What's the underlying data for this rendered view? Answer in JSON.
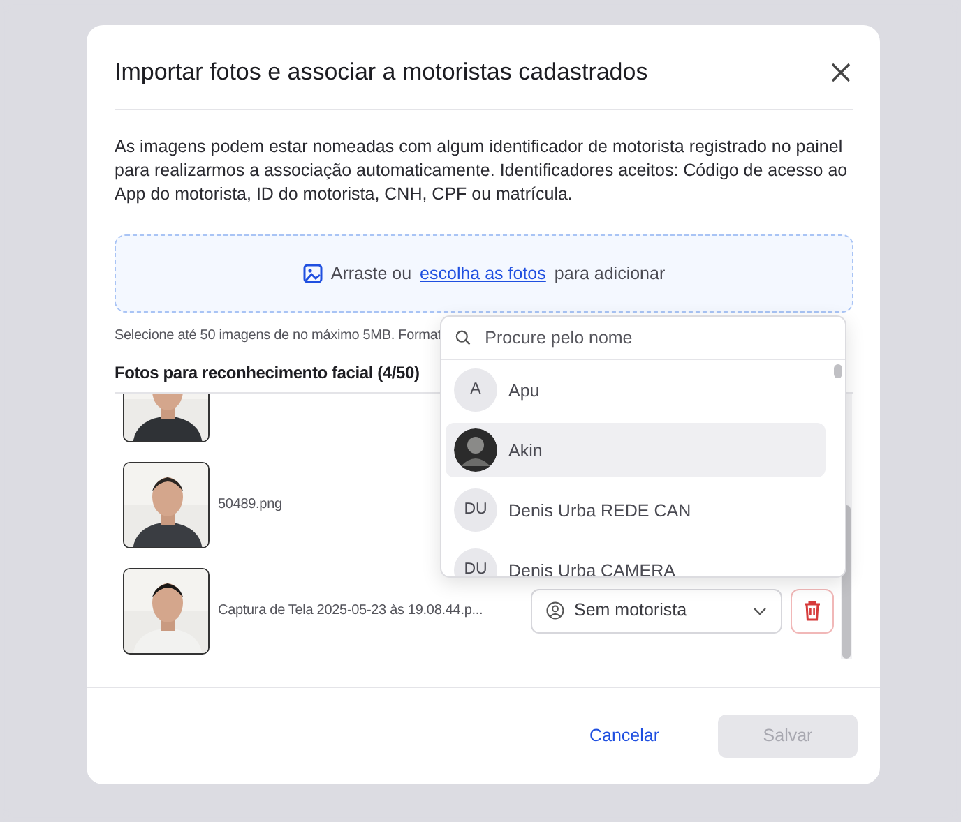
{
  "dialog": {
    "title": "Importar fotos e associar a motoristas cadastrados",
    "description": "As imagens podem estar nomeadas com algum identificador de motorista registrado no painel para realizarmos a associação automaticamente. Identificadores aceitos: Código de acesso ao App do motorista, ID do motorista, CNH, CPF ou matrícula.",
    "dropzone": {
      "before": "Arraste ou",
      "link": "escolha as fotos",
      "after": "para adicionar"
    },
    "hint": "Selecione até 50 imagens de no máximo 5MB. Format",
    "list_title": "Fotos para reconhecimento facial (4/50)",
    "photos": [
      {
        "kind": "picture"
      },
      {
        "kind": "picture",
        "filename": "50489.png"
      },
      {
        "kind": "picture",
        "filename": "Captura de Tela 2025-05-23 às 19.08.44.p...",
        "driver": "Sem motorista"
      }
    ],
    "dropdown": {
      "placeholder": "Procure pelo nome",
      "options": [
        {
          "kind": "initials",
          "initials": "A",
          "name": "Apu",
          "selected": false
        },
        {
          "name": "Akin",
          "selected": true
        },
        {
          "kind": "initials",
          "initials": "DU",
          "name": "Denis Urba REDE CAN",
          "selected": false
        },
        {
          "kind": "initials",
          "initials": "DU",
          "name": "Denis Urba CAMERA",
          "selected": false
        }
      ]
    },
    "cancel": "Cancelar",
    "save": {
      "label": "Salvar",
      "disabled": true
    }
  }
}
